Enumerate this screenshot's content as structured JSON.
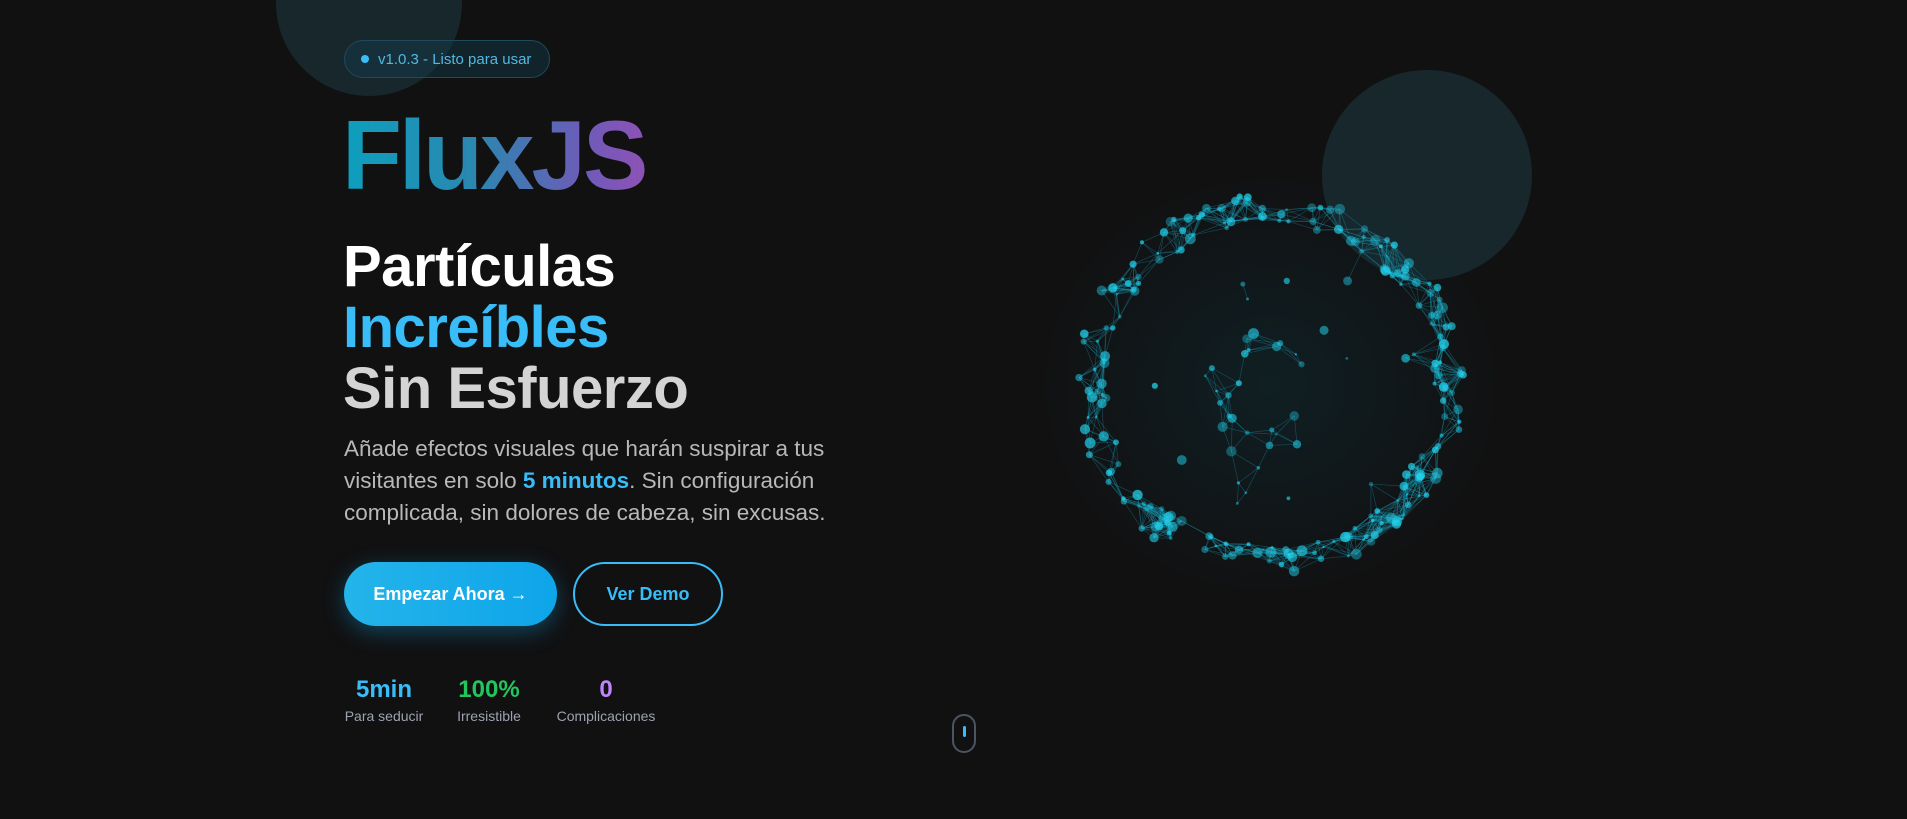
{
  "badge": {
    "text": "v1.0.3 - Listo para usar"
  },
  "brand": {
    "name": "FluxJS"
  },
  "headline": {
    "line1": "Partículas",
    "line2": "Increíbles",
    "line3": "Sin Esfuerzo"
  },
  "description": {
    "part1": "Añade efectos visuales que harán suspirar a tus visitantes en solo ",
    "highlight": "5 minutos",
    "part2": ". Sin configuración complicada, sin dolores de cabeza, sin excusas."
  },
  "buttons": {
    "primary": "Empezar Ahora →",
    "secondary": "Ver Demo"
  },
  "stats": [
    {
      "value": "5min",
      "label": "Para seducir",
      "color": "#38bdf8"
    },
    {
      "value": "100%",
      "label": "Irresistible",
      "color": "#22c55e"
    },
    {
      "value": "0",
      "label": "Complicaciones",
      "color": "#c084fc"
    }
  ],
  "colors": {
    "background": "#111112",
    "accent": "#38bdf8",
    "particle": "#22d3ee"
  }
}
